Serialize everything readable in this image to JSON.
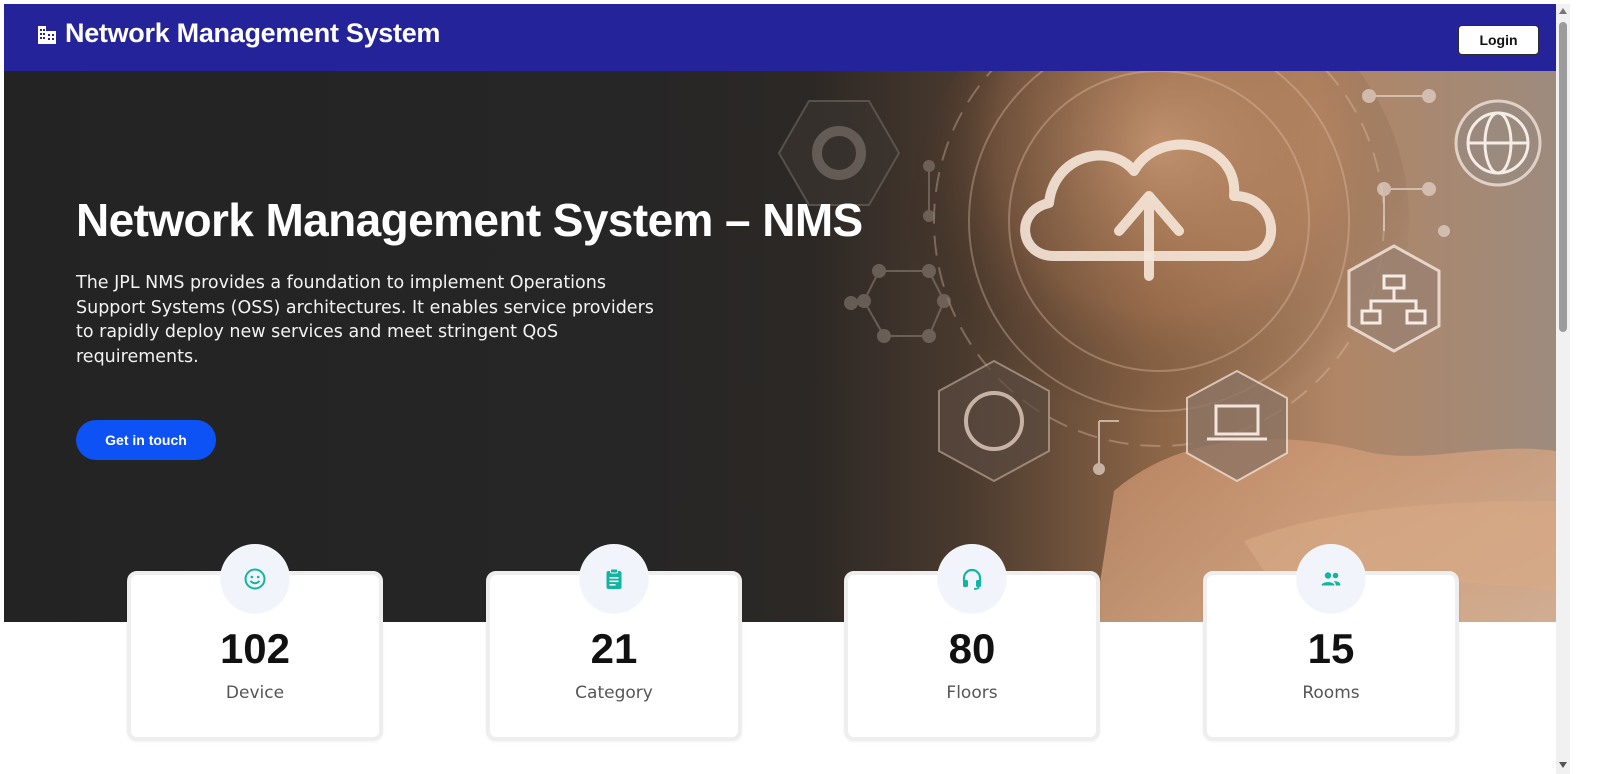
{
  "navbar": {
    "brand_icon": "building-icon",
    "brand_title": "Network Management System",
    "login_label": "Login",
    "background_color": "#24239a"
  },
  "hero": {
    "title": "Network Management System – NMS",
    "description": "The JPL NMS provides a foundation to implement Operations Support Systems (OSS) architectures. It enables service providers to rapidly deploy new services and meet stringent QoS requirements.",
    "cta_label": "Get in touch",
    "cta_color": "#0d52f4"
  },
  "stats": [
    {
      "icon": "smiley-face-icon",
      "value": "102",
      "label": "Device"
    },
    {
      "icon": "clipboard-icon",
      "value": "21",
      "label": "Category"
    },
    {
      "icon": "headset-icon",
      "value": "80",
      "label": "Floors"
    },
    {
      "icon": "people-icon",
      "value": "15",
      "label": "Rooms"
    }
  ],
  "accent_color": "#12b5a0"
}
